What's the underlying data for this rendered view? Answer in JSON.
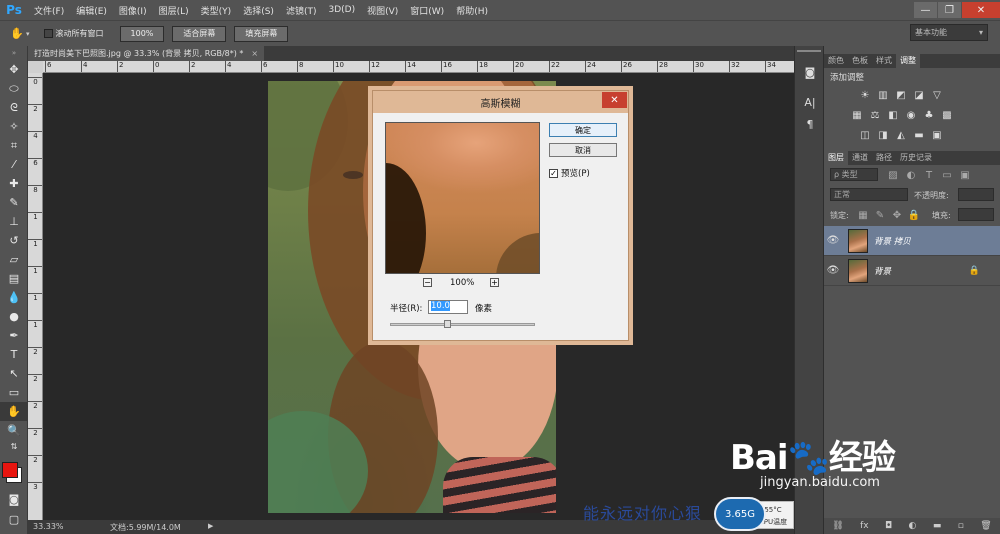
{
  "app": {
    "logo": "Ps",
    "menu": [
      "文件(F)",
      "编辑(E)",
      "图像(I)",
      "图层(L)",
      "类型(Y)",
      "选择(S)",
      "滤镜(T)",
      "3D(D)",
      "视图(V)",
      "窗口(W)",
      "帮助(H)"
    ],
    "window_controls": [
      "—",
      "❐",
      "✕"
    ]
  },
  "options_bar": {
    "scroll_all_label": "滚动所有窗口",
    "zoom_100": "100%",
    "fit_screen": "适合屏幕",
    "fill_screen": "填充屏幕",
    "workspace": "基本功能"
  },
  "document": {
    "tab_title": "打造时尚美下巴照图.jpg @ 33.3% (背景 拷贝, RGB/8*) *",
    "tab_close": "×",
    "ruler_h": [
      "6",
      "4",
      "2",
      "0",
      "2",
      "4",
      "6",
      "8",
      "10",
      "12",
      "14",
      "16",
      "18",
      "20",
      "22",
      "24",
      "26",
      "28",
      "30",
      "32",
      "34"
    ],
    "ruler_v": [
      "0",
      "2",
      "4",
      "6",
      "8",
      "1",
      "1",
      "1",
      "1",
      "1",
      "2",
      "2",
      "2",
      "2",
      "2",
      "3"
    ]
  },
  "status": {
    "zoom": "33.33%",
    "doc_size": "文档:5.99M/14.0M"
  },
  "dialog": {
    "title": "高斯模糊",
    "ok": "确定",
    "cancel": "取消",
    "preview_label": "预览(P)",
    "zoom_minus": "−",
    "zoom_level": "100%",
    "zoom_plus": "+",
    "radius_label": "半径(R):",
    "radius_value": "10.0",
    "radius_unit": "像素",
    "slider_value": 0.4
  },
  "panels": {
    "top_tabs": [
      "颜色",
      "色板",
      "样式",
      "调整"
    ],
    "add_adjustment": "添加调整",
    "layer_tabs": [
      "图层",
      "通道",
      "路径",
      "历史记录"
    ],
    "filter_kind": "ρ 类型",
    "blend_mode": "正常",
    "opacity_label": "不透明度:",
    "lock_label": "锁定:",
    "fill_label": "填充:",
    "layers": [
      {
        "name": "背景 拷贝",
        "selected": true
      },
      {
        "name": "背景",
        "selected": false,
        "locked": true
      }
    ]
  },
  "overlays": {
    "watermark_text": "能永远对你心狠",
    "memory_badge": "3.65G",
    "cpu_temp": "55°C",
    "cpu_label": "CPU温度",
    "baidu_logo": "Bai",
    "baidu_logo_tail": "经验",
    "baidu_url": "jingyan.baidu.com"
  },
  "colors": {
    "foreground": "#e8150f",
    "background": "#ffffff",
    "selected_layer": "#6d7d96",
    "dialog_title": "#dfb896"
  }
}
